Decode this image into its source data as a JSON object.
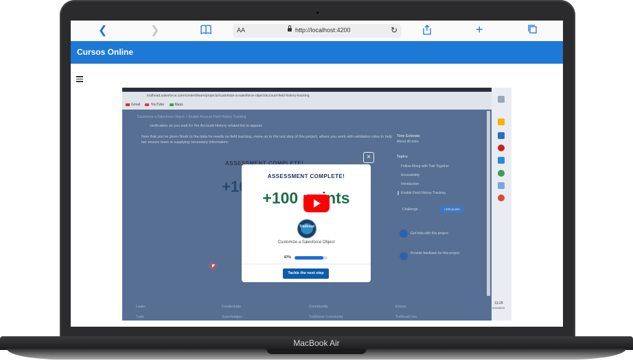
{
  "device": {
    "label": "MacBook Air"
  },
  "browser": {
    "text_size_label": "AA",
    "url": "http://localhost:4200",
    "icons": [
      "back-icon",
      "forward-icon",
      "bookmarks-icon",
      "reload-icon",
      "share-icon",
      "new-tab-icon",
      "tabs-icon"
    ]
  },
  "app": {
    "title": "Cursos Online"
  },
  "video": {
    "inner_browser": {
      "url": "trailhead.salesforce.com/content/learn/projects/customize-a-salesforce-object/account-field-history-tracking",
      "bookmarks": [
        "Gmail",
        "YouTube",
        "Maps"
      ]
    },
    "page": {
      "breadcrumb": "Customize a Salesforce Object  >  Enable Account Field History Tracking",
      "para1": "verification as you wait for the Account History related list to appear.",
      "para2": "Now that you’ve given Noah to the data he needs on field tracking, move on to the last step of this project, where you work with validation rules to help her ensure team is supplying necessary information.",
      "right_panel": {
        "time_label": "Time Estimate",
        "time_value": "About 40 mins",
        "topics_label": "Topics",
        "items": [
          "Follow Along with Trail Together",
          "Accessibility",
          "Introduction",
          "Enable Field History Tracking"
        ],
        "challenge_label": "Challenge",
        "challenge_pill": "+100 points",
        "help": "Get help with this project",
        "feedback": "Provide feedback for this project"
      },
      "footer": [
        "Learn",
        "Credentials",
        "Community",
        "Extras"
      ],
      "footer_sub": [
        "Trails",
        "Superbadges",
        "Trailblazer Community",
        "Trailhead Live"
      ],
      "taskbar_time": "13:29",
      "taskbar_date": "2/22/2023"
    },
    "modal": {
      "title": "ASSESSMENT COMPLETE!",
      "points": "+100 points",
      "badge_text": "Trailhead",
      "caption": "Customize a Salesforce Object",
      "progress_label": "87%",
      "progress_value": 0.87,
      "button": "Tackle the next step",
      "close": "×"
    }
  }
}
